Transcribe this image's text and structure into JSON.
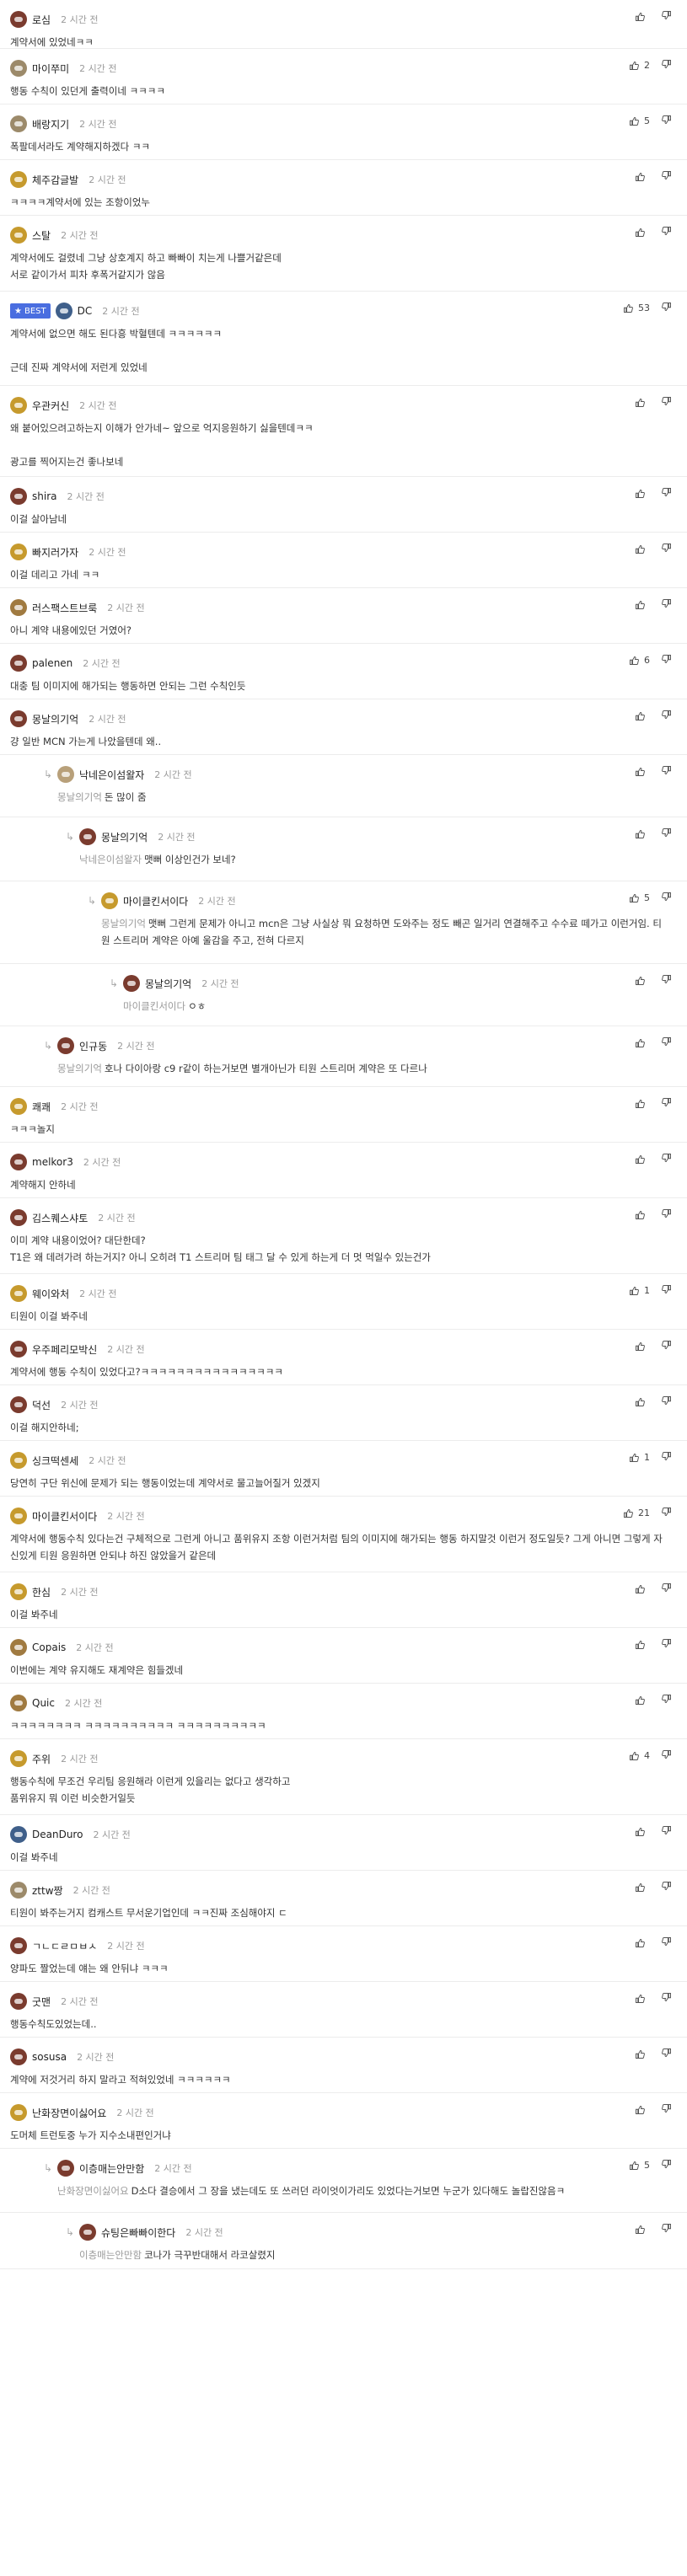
{
  "comments": [
    {
      "nick": "로심",
      "time": "2 시간 전",
      "text": "계약서에 있었네ㅋㅋ",
      "likes": "",
      "avatar": "#7a3b2e",
      "depth": 0,
      "h": 58
    },
    {
      "nick": "마이쭈미",
      "time": "2 시간 전",
      "text": "행동 수칙이 있던게 출력이네 ㅋㅋㅋㅋ",
      "likes": "2",
      "avatar": "#9c8a6a",
      "depth": 0,
      "h": 66
    },
    {
      "nick": "배랑지기",
      "time": "2 시간 전",
      "text": "폭팔데서라도 계약해지하겠다 ㅋㅋ",
      "likes": "5",
      "avatar": "#9c8a6a",
      "depth": 0,
      "h": 66
    },
    {
      "nick": "체주감글발",
      "time": "2 시간 전",
      "text": "ㅋㅋㅋㅋ계약서에 있는 조항이었누",
      "likes": "",
      "avatar": "#c69a2d",
      "depth": 0,
      "h": 66
    },
    {
      "nick": "스탈",
      "time": "2 시간 전",
      "text": "계약서에도 걸렸네 그냥 상호계지 하고 빠빠이 치는게 나쁠거같은데\n서로 같이가서 피차 후폭거같지가 않음",
      "likes": "",
      "avatar": "#c69a2d",
      "depth": 0,
      "h": 90
    },
    {
      "nick": "DC",
      "time": "2 시간 전",
      "text": "계약서에 없으면 해도 된다흥 박혈텐데 ㅋㅋㅋㅋㅋㅋ\n\n근데 진짜 계약서에 저런게 있었네",
      "likes": "53",
      "avatar": "#3f5f8a",
      "depth": 0,
      "h": 112,
      "best": true
    },
    {
      "nick": "우관커신",
      "time": "2 시간 전",
      "text": "왜 붙어있으려고하는지 이해가 안가네~ 앞으로 억지응원하기 싫을텐데ㅋㅋ\n\n광고를 찍어지는건 좋나보네",
      "likes": "",
      "avatar": "#c69a2d",
      "depth": 0,
      "h": 108
    },
    {
      "nick": "shira",
      "time": "2 시간 전",
      "text": "이걸 살아남네",
      "likes": "",
      "avatar": "#7a3b2e",
      "depth": 0,
      "h": 66
    },
    {
      "nick": "빠지러가자",
      "time": "2 시간 전",
      "text": "이걸 데리고 가네 ㅋㅋ",
      "likes": "",
      "avatar": "#c69a2d",
      "depth": 0,
      "h": 66
    },
    {
      "nick": "러스팩스트브룩",
      "time": "2 시간 전",
      "text": "아니 계약 내용에있던 거였어?",
      "likes": "",
      "avatar": "#a07a40",
      "depth": 0,
      "h": 66
    },
    {
      "nick": "palenen",
      "time": "2 시간 전",
      "text": "대충 팀 이미지에 해가되는 행동하면 안되는 그런 수칙인듯",
      "likes": "6",
      "avatar": "#7a3b2e",
      "depth": 0,
      "h": 66
    },
    {
      "nick": "몽날의기억",
      "time": "2 시간 전",
      "text": "걍 일반 MCN 가는게 나았을텐데 왜..",
      "likes": "",
      "avatar": "#7a3b2e",
      "depth": 0,
      "h": 66
    },
    {
      "nick": "낙네은이섬왈자",
      "time": "2 시간 전",
      "quote": "몽날의기억",
      "text": "돈 많이 줌",
      "likes": "",
      "avatar": "#b8a07a",
      "depth": 1,
      "h": 74
    },
    {
      "nick": "몽날의기억",
      "time": "2 시간 전",
      "quote": "낙네은이섬왈자",
      "text": "맷뻐 이상인건가 보네?",
      "likes": "",
      "avatar": "#7a3b2e",
      "depth": 2,
      "h": 76
    },
    {
      "nick": "마이클킨서이다",
      "time": "2 시간 전",
      "quote": "몽날의기억",
      "text": "맷뻐 그런게 문제가 아니고 mcn은 그냥 사실상 뭐 요청하면 도와주는 정도 빼곤 일거리 연결해주고 수수료 떼가고 이런거임. 티원 스트리머 계약은 아예 울감을 주고, 전혀 다르지",
      "likes": "5",
      "avatar": "#c69a2d",
      "depth": 3,
      "h": 98
    },
    {
      "nick": "몽날의기억",
      "time": "2 시간 전",
      "quote": "마이클킨서이다",
      "text": "ㅇㅎ",
      "likes": "",
      "avatar": "#7a3b2e",
      "depth": 4,
      "h": 74
    },
    {
      "nick": "인규동",
      "time": "2 시간 전",
      "quote": "몽날의기억",
      "text": "호나 다이아랑 c9 r같이 하는거보면 별개아닌가 티원 스트리머 계약은 또 다르나",
      "likes": "",
      "avatar": "#7a3b2e",
      "depth": 1,
      "h": 72
    },
    {
      "nick": "쾌쾌",
      "time": "2 시간 전",
      "text": "ㅋㅋㅋ놀지",
      "likes": "",
      "avatar": "#c69a2d",
      "depth": 0,
      "h": 66
    },
    {
      "nick": "melkor3",
      "time": "2 시간 전",
      "text": "계약해지 안하네",
      "likes": "",
      "avatar": "#7a3b2e",
      "depth": 0,
      "h": 66
    },
    {
      "nick": "김스퀘스샤토",
      "time": "2 시간 전",
      "text": "이미 계약 내용이었어? 대단한데?\nT1은 왜 데려가려 하는거지? 아니 오히려 T1 스트리머 팀 태그 달 수 있게 하는게 더 멋 먹일수 있는건가",
      "likes": "",
      "avatar": "#7a3b2e",
      "depth": 0,
      "h": 90
    },
    {
      "nick": "웨이와처",
      "time": "2 시간 전",
      "text": "티원이 이걸 봐주네",
      "likes": "1",
      "avatar": "#c69a2d",
      "depth": 0,
      "h": 66
    },
    {
      "nick": "우주페리모박신",
      "time": "2 시간 전",
      "text": "계약서에 행동 수칙이 있었다고?ㅋㅋㅋㅋㅋㅋㅋㅋㅋㅋㅋㅋㅋㅋㅋㅋ",
      "likes": "",
      "avatar": "#7a3b2e",
      "depth": 0,
      "h": 66
    },
    {
      "nick": "덕선",
      "time": "2 시간 전",
      "text": "이걸 해지안하네;",
      "likes": "",
      "avatar": "#7a3b2e",
      "depth": 0,
      "h": 66
    },
    {
      "nick": "싱크떡센세",
      "time": "2 시간 전",
      "text": "당연히 구단 위신에 문제가 되는 행동이었는데 계약서로 물고늘어질거 있겠지",
      "likes": "1",
      "avatar": "#c69a2d",
      "depth": 0,
      "h": 66
    },
    {
      "nick": "마이클킨서이다",
      "time": "2 시간 전",
      "text": "계약서에 행동수칙 있다는건 구체적으로 그런게 아니고 품위유지 조항 이런거처럼 팀의 이미지에 해가되는 행동 하지말것 이런거 정도일듯? 그게 아니면 그렇게 자신있게 티원 응원하면 안되냐 하진 않았을거 같은데",
      "likes": "21",
      "avatar": "#c69a2d",
      "depth": 0,
      "h": 90
    },
    {
      "nick": "한심",
      "time": "2 시간 전",
      "text": "이걸 봐주네",
      "likes": "",
      "avatar": "#c69a2d",
      "depth": 0,
      "h": 66
    },
    {
      "nick": "Copais",
      "time": "2 시간 전",
      "text": "이번에는 계약 유지해도 재계약은 힘들겠네",
      "likes": "",
      "avatar": "#a07a40",
      "depth": 0,
      "h": 66
    },
    {
      "nick": "Quic",
      "time": "2 시간 전",
      "text": "ㅋㅋㅋㅋㅋㅋㅋㅋ ㅋㅋㅋㅋㅋㅋㅋㅋㅋㅋ ㅋㅋㅋㅋㅋㅋㅋㅋㅋㅋ",
      "likes": "",
      "avatar": "#a07a40",
      "depth": 0,
      "h": 66
    },
    {
      "nick": "주위",
      "time": "2 시간 전",
      "text": "행동수칙에 무조건 우리팀 응원해라 이런게 있을리는 없다고 생각하고\n품위유지 뭐 이런 비슷한거일듯",
      "likes": "4",
      "avatar": "#c69a2d",
      "depth": 0,
      "h": 90
    },
    {
      "nick": "DeanDuro",
      "time": "2 시간 전",
      "text": "이걸 봐주네",
      "likes": "",
      "avatar": "#3f5f8a",
      "depth": 0,
      "h": 66
    },
    {
      "nick": "zttw짱",
      "time": "2 시간 전",
      "text": "티원이 봐주는거지 컴캐스트 무서운기업인데 ㅋㅋ진짜 조심해야지 ㄷ",
      "likes": "",
      "avatar": "#9c8a6a",
      "depth": 0,
      "h": 66
    },
    {
      "nick": "ㄱㄴㄷㄹㅁㅂㅅ",
      "time": "2 시간 전",
      "text": "양파도 짤었는데 얘는 왜 안뒤냐 ㅋㅋㅋ",
      "likes": "",
      "avatar": "#7a3b2e",
      "depth": 0,
      "h": 66
    },
    {
      "nick": "굿맨",
      "time": "2 시간 전",
      "text": "행동수칙도있었는데..",
      "likes": "",
      "avatar": "#7a3b2e",
      "depth": 0,
      "h": 66
    },
    {
      "nick": "sosusa",
      "time": "2 시간 전",
      "text": "계약에 저것거리 하지 말라고 적혀있었네 ㅋㅋㅋㅋㅋㅋ",
      "likes": "",
      "avatar": "#7a3b2e",
      "depth": 0,
      "h": 66
    },
    {
      "nick": "난화장면이싫어요",
      "time": "2 시간 전",
      "text": "도머체 트런토중 누가 지수소내편인거냐",
      "likes": "",
      "avatar": "#c69a2d",
      "depth": 0,
      "h": 66
    },
    {
      "nick": "이층매는안만함",
      "time": "2 시간 전",
      "quote": "난화장면이싫어요",
      "text": "D소다 결승에서 그 장을 냈는데도 또 쓰러던 라이엇이가리도 있었다는거보면 누군가 있다해도 놀랍진않음ㅋ",
      "likes": "5",
      "avatar": "#7a3b2e",
      "depth": 1,
      "h": 76
    },
    {
      "nick": "슈팅은빠빠이한다",
      "time": "2 시간 전",
      "quote": "이층매는안만함",
      "text": "코나가 극꾸반대해서 라코살렸지",
      "likes": "",
      "avatar": "#7a3b2e",
      "depth": 2,
      "h": 67
    }
  ]
}
